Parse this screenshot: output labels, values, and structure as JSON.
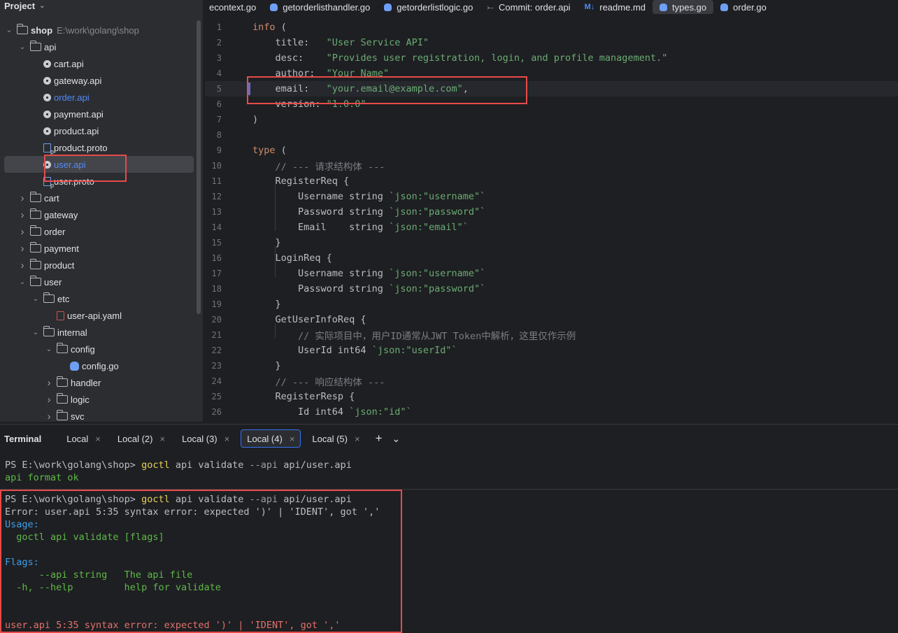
{
  "project": {
    "title": "Project",
    "tree": [
      {
        "label": "shop",
        "path": "E:\\work\\golang\\shop",
        "depth": 0,
        "type": "folder",
        "open": true
      },
      {
        "label": "api",
        "depth": 1,
        "type": "folder",
        "open": true
      },
      {
        "label": "cart.api",
        "depth": 2,
        "type": "api"
      },
      {
        "label": "gateway.api",
        "depth": 2,
        "type": "api"
      },
      {
        "label": "order.api",
        "depth": 2,
        "type": "api",
        "blue": true
      },
      {
        "label": "payment.api",
        "depth": 2,
        "type": "api"
      },
      {
        "label": "product.api",
        "depth": 2,
        "type": "api"
      },
      {
        "label": "product.proto",
        "depth": 2,
        "type": "proto"
      },
      {
        "label": "user.api",
        "depth": 2,
        "type": "api",
        "blue": true,
        "selected": true
      },
      {
        "label": "user.proto",
        "depth": 2,
        "type": "proto"
      },
      {
        "label": "cart",
        "depth": 1,
        "type": "folder",
        "open": false
      },
      {
        "label": "gateway",
        "depth": 1,
        "type": "folder",
        "open": false
      },
      {
        "label": "order",
        "depth": 1,
        "type": "folder",
        "open": false
      },
      {
        "label": "payment",
        "depth": 1,
        "type": "folder",
        "open": false
      },
      {
        "label": "product",
        "depth": 1,
        "type": "folder",
        "open": false
      },
      {
        "label": "user",
        "depth": 1,
        "type": "folder",
        "open": true
      },
      {
        "label": "etc",
        "depth": 2,
        "type": "folder",
        "open": true
      },
      {
        "label": "user-api.yaml",
        "depth": 3,
        "type": "yaml"
      },
      {
        "label": "internal",
        "depth": 2,
        "type": "folder",
        "open": true
      },
      {
        "label": "config",
        "depth": 3,
        "type": "folder",
        "open": true
      },
      {
        "label": "config.go",
        "depth": 4,
        "type": "go"
      },
      {
        "label": "handler",
        "depth": 3,
        "type": "folder",
        "open": false
      },
      {
        "label": "logic",
        "depth": 3,
        "type": "folder",
        "open": false
      },
      {
        "label": "svc",
        "depth": 3,
        "type": "folder",
        "open": false
      }
    ]
  },
  "editor": {
    "tabs": [
      {
        "label": "econtext.go",
        "icon": "none"
      },
      {
        "label": "getorderlisthandler.go",
        "icon": "go"
      },
      {
        "label": "getorderlistlogic.go",
        "icon": "go"
      },
      {
        "label": "Commit: order.api",
        "icon": "commit"
      },
      {
        "label": "readme.md",
        "icon": "md"
      },
      {
        "label": "types.go",
        "icon": "go",
        "active": true
      },
      {
        "label": "order.go",
        "icon": "go"
      }
    ],
    "md_icon": "M↓",
    "commit_icon": "⤚",
    "lines": [
      {
        "n": "1",
        "segs": [
          {
            "t": "info",
            "c": "kw"
          },
          {
            "t": " (",
            "c": ""
          }
        ]
      },
      {
        "n": "2",
        "segs": [
          {
            "t": "    title:   ",
            "c": ""
          },
          {
            "t": "\"User Service API\"",
            "c": "str"
          }
        ]
      },
      {
        "n": "3",
        "segs": [
          {
            "t": "    desc:    ",
            "c": ""
          },
          {
            "t": "\"Provides user registration, login, and profile management.\"",
            "c": "str"
          }
        ]
      },
      {
        "n": "4",
        "segs": [
          {
            "t": "    author:  ",
            "c": ""
          },
          {
            "t": "\"Your Name\"",
            "c": "str"
          }
        ]
      },
      {
        "n": "5",
        "segs": [
          {
            "t": "    email:   ",
            "c": ""
          },
          {
            "t": "\"your.email@example.com\"",
            "c": "str"
          },
          {
            "t": ",",
            "c": ""
          }
        ],
        "current": true
      },
      {
        "n": "6",
        "segs": [
          {
            "t": "    version: ",
            "c": ""
          },
          {
            "t": "\"1.0.0\"",
            "c": "str"
          }
        ]
      },
      {
        "n": "7",
        "segs": [
          {
            "t": ")",
            "c": ""
          }
        ]
      },
      {
        "n": "8",
        "segs": []
      },
      {
        "n": "9",
        "segs": [
          {
            "t": "type",
            "c": "kw"
          },
          {
            "t": " (",
            "c": ""
          }
        ]
      },
      {
        "n": "10",
        "segs": [
          {
            "t": "    // --- 请求结构体 ---",
            "c": "cmt"
          }
        ]
      },
      {
        "n": "11",
        "segs": [
          {
            "t": "    RegisterReq {",
            "c": ""
          }
        ]
      },
      {
        "n": "12",
        "segs": [
          {
            "t": "        Username string ",
            "c": ""
          },
          {
            "t": "`json:\"username\"`",
            "c": "str"
          }
        ]
      },
      {
        "n": "13",
        "segs": [
          {
            "t": "        Password string ",
            "c": ""
          },
          {
            "t": "`json:\"password\"`",
            "c": "str"
          }
        ]
      },
      {
        "n": "14",
        "segs": [
          {
            "t": "        Email    string ",
            "c": ""
          },
          {
            "t": "`json:\"email\"`",
            "c": "str"
          }
        ]
      },
      {
        "n": "15",
        "segs": [
          {
            "t": "    }",
            "c": ""
          }
        ]
      },
      {
        "n": "16",
        "segs": [
          {
            "t": "    LoginReq {",
            "c": ""
          }
        ]
      },
      {
        "n": "17",
        "segs": [
          {
            "t": "        Username string ",
            "c": ""
          },
          {
            "t": "`json:\"username\"`",
            "c": "str"
          }
        ]
      },
      {
        "n": "18",
        "segs": [
          {
            "t": "        Password string ",
            "c": ""
          },
          {
            "t": "`json:\"password\"`",
            "c": "str"
          }
        ]
      },
      {
        "n": "19",
        "segs": [
          {
            "t": "    }",
            "c": ""
          }
        ]
      },
      {
        "n": "20",
        "segs": [
          {
            "t": "    GetUserInfoReq {",
            "c": ""
          }
        ]
      },
      {
        "n": "21",
        "segs": [
          {
            "t": "        // 实际项目中，用户ID通常从JWT Token中解析，这里仅作示例",
            "c": "cmt"
          }
        ]
      },
      {
        "n": "22",
        "segs": [
          {
            "t": "        UserId int64 ",
            "c": ""
          },
          {
            "t": "`json:\"userId\"`",
            "c": "str"
          }
        ]
      },
      {
        "n": "23",
        "segs": [
          {
            "t": "    }",
            "c": ""
          }
        ]
      },
      {
        "n": "24",
        "segs": [
          {
            "t": "    // --- 响应结构体 ---",
            "c": "cmt"
          }
        ]
      },
      {
        "n": "25",
        "segs": [
          {
            "t": "    RegisterResp {",
            "c": ""
          }
        ]
      },
      {
        "n": "26",
        "segs": [
          {
            "t": "        Id int64 ",
            "c": ""
          },
          {
            "t": "`json:\"id\"`",
            "c": "str"
          }
        ]
      }
    ]
  },
  "terminal": {
    "title": "Terminal",
    "tabs": [
      {
        "label": "Local",
        "active": false
      },
      {
        "label": "Local (2)",
        "active": false
      },
      {
        "label": "Local (3)",
        "active": false
      },
      {
        "label": "Local (4)",
        "active": true
      },
      {
        "label": "Local (5)",
        "active": false
      }
    ],
    "close_glyph": "×",
    "add_glyph": "+",
    "menu_glyph": "⌄",
    "block1": [
      [
        {
          "t": "PS E:\\work\\golang\\shop> ",
          "c": ""
        },
        {
          "t": "goctl",
          "c": "cmd"
        },
        {
          "t": " api validate ",
          "c": ""
        },
        {
          "t": "--api",
          "c": "gray"
        },
        {
          "t": " api/user.api",
          "c": ""
        }
      ],
      [
        {
          "t": "api format ok",
          "c": "green"
        }
      ]
    ],
    "block2": [
      [
        {
          "t": "PS E:\\work\\golang\\shop> ",
          "c": ""
        },
        {
          "t": "goctl",
          "c": "cmd"
        },
        {
          "t": " api validate ",
          "c": ""
        },
        {
          "t": "--api",
          "c": "gray"
        },
        {
          "t": " api/user.api",
          "c": ""
        }
      ],
      [
        {
          "t": "Error: user.api 5:35 syntax error: expected ')' | 'IDENT', got ','",
          "c": ""
        }
      ],
      [
        {
          "t": "Usage:",
          "c": "blue"
        }
      ],
      [
        {
          "t": "  goctl api validate [flags]",
          "c": "green"
        }
      ],
      [
        {
          "t": "",
          "c": ""
        }
      ],
      [
        {
          "t": "Flags:",
          "c": "blue"
        }
      ],
      [
        {
          "t": "      --api string   The api file",
          "c": "green"
        }
      ],
      [
        {
          "t": "  -h, --help         help for validate",
          "c": "green"
        }
      ],
      [
        {
          "t": "",
          "c": ""
        }
      ],
      [
        {
          "t": "",
          "c": ""
        }
      ],
      [
        {
          "t": "user.api 5:35 syntax error: expected ')' | 'IDENT', got ','",
          "c": "red"
        }
      ]
    ]
  },
  "colors": {
    "annotation": "#e84a4a",
    "accent": "#3574f0"
  }
}
